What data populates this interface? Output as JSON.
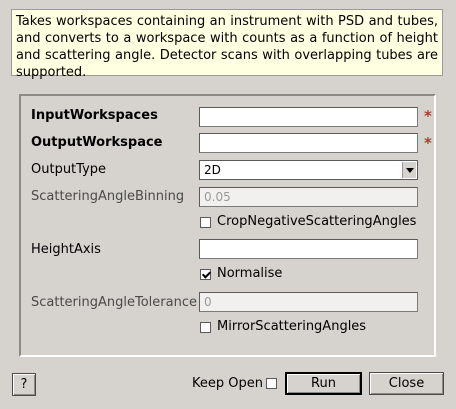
{
  "description": "Takes workspaces containing an instrument with PSD and tubes, and converts to a workspace with counts as a function of height and scattering angle. Detector scans with overlapping tubes are supported.",
  "properties": {
    "input_workspaces": {
      "label": "InputWorkspaces",
      "value": "",
      "required_marker": "*"
    },
    "output_workspace": {
      "label": "OutputWorkspace",
      "value": "",
      "required_marker": "*"
    },
    "output_type": {
      "label": "OutputType",
      "value": "2D"
    },
    "scattering_angle_binning": {
      "label": "ScatteringAngleBinning",
      "placeholder": "0.05"
    },
    "crop_negative": {
      "label": "CropNegativeScatteringAngles",
      "checked": false
    },
    "height_axis": {
      "label": "HeightAxis",
      "value": ""
    },
    "normalise": {
      "label": "Normalise",
      "checked": true
    },
    "scattering_angle_tolerance": {
      "label": "ScatteringAngleTolerance",
      "placeholder": "0"
    },
    "mirror": {
      "label": "MirrorScatteringAngles",
      "checked": false
    }
  },
  "footer": {
    "help_label": "?",
    "keep_open_label": "Keep Open",
    "keep_open_checked": false,
    "run_label": "Run",
    "close_label": "Close"
  },
  "colors": {
    "description_bg": "#ffffe1",
    "required_marker": "#b03a2e",
    "window_bg": "#d6d3ce"
  }
}
